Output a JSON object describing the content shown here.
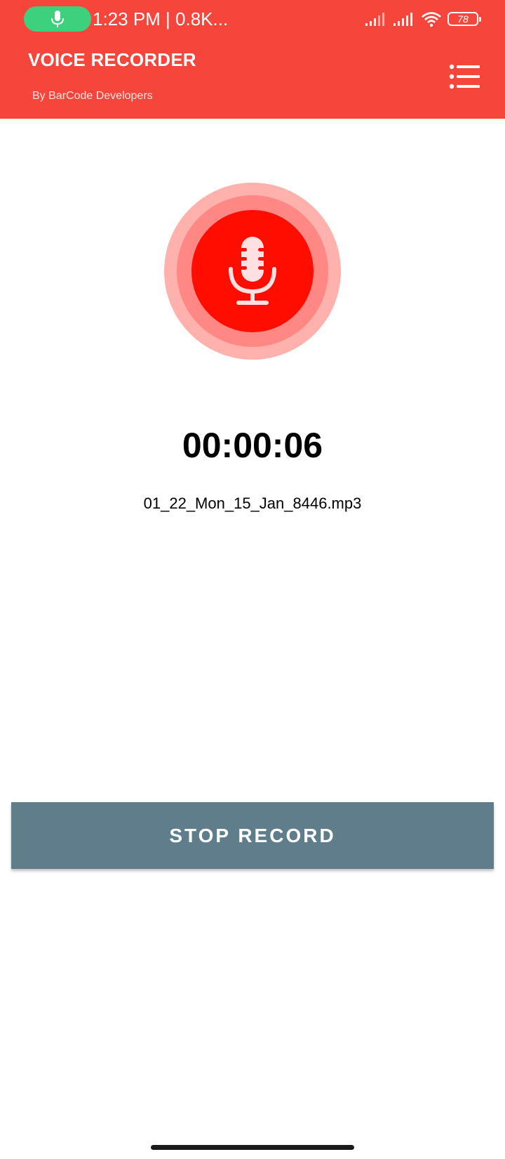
{
  "status_bar": {
    "time_text": "1:23 PM | 0.8K...",
    "battery_level": "78",
    "icons": [
      "microphone-icon",
      "signal-icon",
      "signal-icon",
      "wifi-icon",
      "battery-icon"
    ]
  },
  "app_bar": {
    "title": "VOICE RECORDER",
    "subtitle": "By BarCode Developers",
    "menu_icon": "list-icon"
  },
  "recorder": {
    "icon": "microphone-icon",
    "timer": "00:00:06",
    "filename": "01_22_Mon_15_Jan_8446.mp3",
    "stop_label": "STOP RECORD"
  },
  "colors": {
    "app_bar": "#f6463c",
    "status_pill": "#3dd17d",
    "rec_outer_ring": "#ffb1ae",
    "rec_middle_ring": "#ff8884",
    "rec_core": "#ff0d00",
    "stop_button": "#607d8b"
  }
}
